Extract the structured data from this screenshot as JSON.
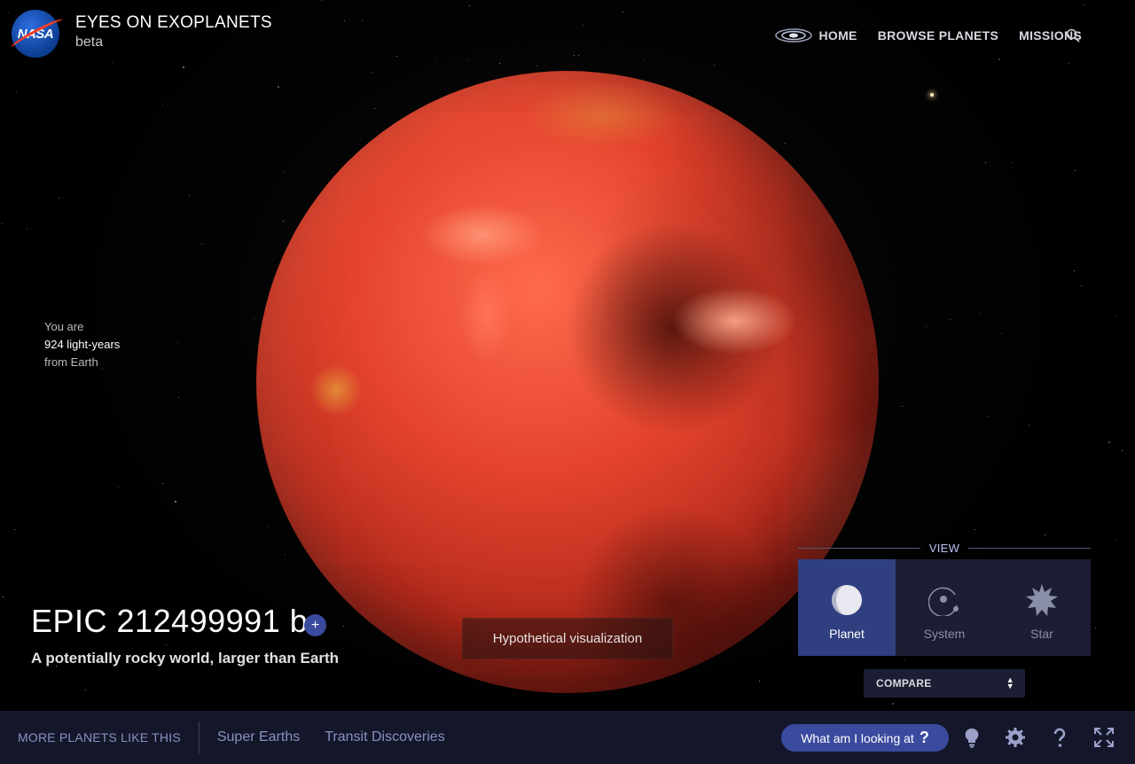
{
  "header": {
    "logo_text": "NASA",
    "title": "EYES ON EXOPLANETS",
    "subtitle": "beta",
    "nav": [
      {
        "label": "HOME",
        "icon": "galaxy-icon"
      },
      {
        "label": "BROWSE PLANETS"
      },
      {
        "label": "MISSIONS"
      }
    ],
    "search_icon": "search-icon"
  },
  "distance": {
    "line1": "You are",
    "line2": "924 light-years",
    "line3": "from Earth"
  },
  "planet": {
    "name": "EPIC 212499991 b",
    "add_label": "+",
    "tagline": "A potentially rocky world, larger than Earth",
    "visualization_note": "Hypothetical visualization"
  },
  "view": {
    "label": "VIEW",
    "options": [
      {
        "label": "Planet",
        "icon": "planet-icon",
        "active": true
      },
      {
        "label": "System",
        "icon": "system-icon",
        "active": false
      },
      {
        "label": "Star",
        "icon": "star-icon",
        "active": false
      }
    ],
    "compare_label": "COMPARE"
  },
  "footer": {
    "more_label": "MORE PLANETS LIKE THIS",
    "links": [
      "Super Earths",
      "Transit Discoveries"
    ],
    "what_label": "What am I looking at",
    "what_q": "?",
    "icons": [
      "lightbulb-icon",
      "settings-icon",
      "help-icon",
      "fullscreen-icon"
    ]
  },
  "colors": {
    "accent": "#3a4a9e",
    "panel": "#1c1f33",
    "active": "#2f3f80",
    "footer": "#14172a"
  }
}
